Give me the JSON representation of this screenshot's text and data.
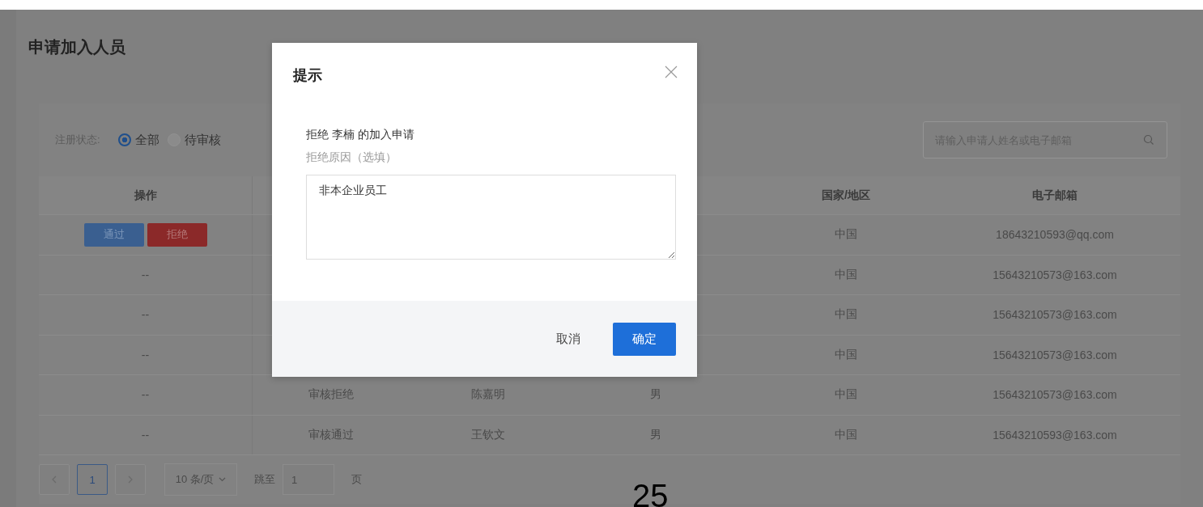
{
  "page": {
    "title": "申请加入人员"
  },
  "filter": {
    "label": "注册状态:",
    "options": [
      {
        "label": "全部",
        "selected": true
      },
      {
        "label": "待审核",
        "selected": false
      }
    ]
  },
  "search": {
    "placeholder": "请输入申请人姓名或电子邮箱"
  },
  "table": {
    "columns": [
      "操作",
      null,
      null,
      null,
      "国家/地区",
      "电子邮箱"
    ],
    "rows": [
      {
        "kind": "pending",
        "actions": [
          {
            "label": "通过",
            "kind": "approve"
          },
          {
            "label": "拒绝",
            "kind": "reject"
          }
        ],
        "cells": [
          null,
          null,
          null,
          null,
          "中国",
          "18643210593@qq.com"
        ]
      },
      {
        "kind": "done",
        "cells": [
          "--",
          null,
          null,
          null,
          "中国",
          "15643210573@163.com"
        ]
      },
      {
        "kind": "done",
        "cells": [
          "--",
          null,
          null,
          null,
          "中国",
          "15643210573@163.com"
        ]
      },
      {
        "kind": "done",
        "cells": [
          "--",
          null,
          null,
          null,
          "中国",
          "15643210573@163.com"
        ]
      },
      {
        "kind": "done",
        "cells": [
          "--",
          "审核拒绝",
          "陈嘉明",
          "男",
          "中国",
          "15643210573@163.com"
        ]
      },
      {
        "kind": "done",
        "cells": [
          "--",
          "审核通过",
          "王钦文",
          "男",
          "中国",
          "15643210593@163.com"
        ]
      }
    ]
  },
  "pagination": {
    "pages": [
      {
        "label": "1",
        "selected": true
      }
    ],
    "page_size": "10 条/页",
    "jump_label": "跳至",
    "jump_value": "1",
    "page_suffix": "页"
  },
  "page_number": "25",
  "dialog": {
    "title": "提示",
    "message": "拒绝 李楠 的加入申请",
    "reason_label": "拒绝原因（选填）",
    "reason_value": "非本企业员工",
    "buttons": [
      {
        "label": "取消",
        "kind": "secondary"
      },
      {
        "label": "确定",
        "kind": "primary"
      }
    ]
  }
}
